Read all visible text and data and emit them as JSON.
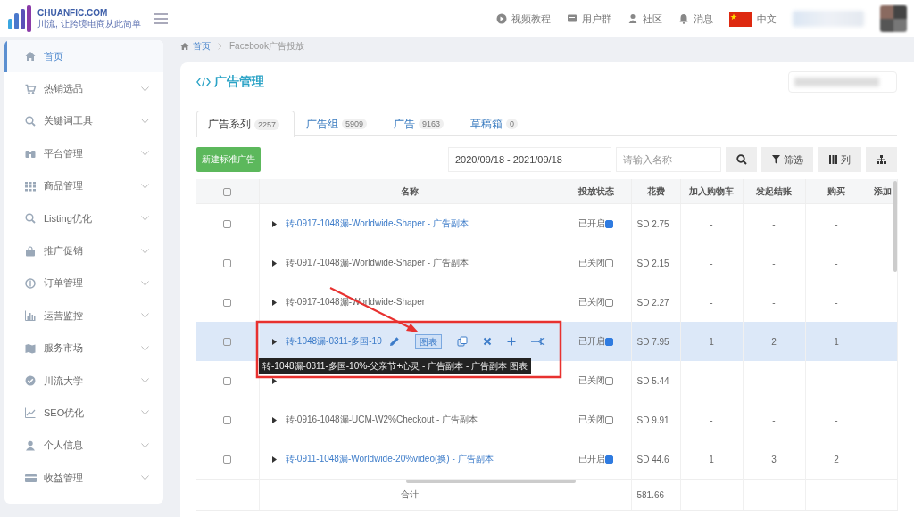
{
  "topbar": {
    "logo_title": "CHUANFIC.COM",
    "logo_subtitle": "川流, 让跨境电商从此简单",
    "links": [
      {
        "label": "视频教程"
      },
      {
        "label": "用户群"
      },
      {
        "label": "社区"
      },
      {
        "label": "消息"
      }
    ],
    "language": "中文"
  },
  "sidebar": {
    "items": [
      {
        "label": "首页",
        "selected": true,
        "expandable": false
      },
      {
        "label": "热销选品",
        "selected": false,
        "expandable": true
      },
      {
        "label": "关键词工具",
        "selected": false,
        "expandable": true
      },
      {
        "label": "平台管理",
        "selected": false,
        "expandable": true
      },
      {
        "label": "商品管理",
        "selected": false,
        "expandable": true
      },
      {
        "label": "Listing优化",
        "selected": false,
        "expandable": true
      },
      {
        "label": "推广促销",
        "selected": false,
        "expandable": true
      },
      {
        "label": "订单管理",
        "selected": false,
        "expandable": true
      },
      {
        "label": "运营监控",
        "selected": false,
        "expandable": true
      },
      {
        "label": "服务市场",
        "selected": false,
        "expandable": true
      },
      {
        "label": "川流大学",
        "selected": false,
        "expandable": true
      },
      {
        "label": "SEO优化",
        "selected": false,
        "expandable": true
      },
      {
        "label": "个人信息",
        "selected": false,
        "expandable": true
      },
      {
        "label": "收益管理",
        "selected": false,
        "expandable": true
      }
    ]
  },
  "breadcrumb": [
    "首页",
    "Facebook广告投放"
  ],
  "card": {
    "title": "广告管理"
  },
  "tabs": [
    {
      "label": "广告系列",
      "count": "2257",
      "selected": true
    },
    {
      "label": "广告组",
      "count": "5909",
      "selected": false
    },
    {
      "label": "广告",
      "count": "9163",
      "selected": false
    },
    {
      "label": "草稿箱",
      "count": "0",
      "selected": false
    }
  ],
  "toolbar": {
    "new_button": "新建标准广告",
    "date_range": "2020/09/18 - 2021/09/18",
    "search_placeholder": "请输入名称",
    "filter_button": "筛选",
    "columns_button": "列"
  },
  "table": {
    "all_checked": false,
    "columns": [
      "名称",
      "投放状态",
      "花费",
      "加入购物车",
      "发起结账",
      "购买",
      "添加"
    ],
    "rows": [
      {
        "checked": false,
        "selected": false,
        "name": "转-0917-1048漏-Worldwide-Shaper - 广告副本",
        "enabled": true,
        "status": "已开启",
        "spend": "SD 2.75",
        "cart": "-",
        "checkout": "-",
        "purchase": "-"
      },
      {
        "checked": false,
        "selected": false,
        "name": "转-0917-1048漏-Worldwide-Shaper - 广告副本",
        "enabled": false,
        "status": "已关闭",
        "spend": "SD 2.15",
        "cart": "-",
        "checkout": "-",
        "purchase": "-"
      },
      {
        "checked": false,
        "selected": false,
        "name": "转-0917-1048漏-Worldwide-Shaper",
        "enabled": false,
        "status": "已关闭",
        "spend": "SD 2.27",
        "cart": "-",
        "checkout": "-",
        "purchase": "-"
      },
      {
        "checked": false,
        "selected": true,
        "name": "转-1048漏-0311-多国-10",
        "enabled": true,
        "status": "已开启",
        "spend": "SD 7.95",
        "cart": "1",
        "checkout": "2",
        "purchase": "1",
        "actions": [
          {
            "kind": "edit"
          },
          {
            "kind": "chart",
            "label": "图表"
          },
          {
            "kind": "copy"
          },
          {
            "kind": "delete"
          },
          {
            "kind": "add"
          },
          {
            "kind": "split"
          }
        ]
      },
      {
        "checked": false,
        "selected": false,
        "enabled": false,
        "status": "已关闭",
        "spend": "SD 5.44",
        "cart": "-",
        "checkout": "-",
        "purchase": "-"
      },
      {
        "checked": false,
        "selected": false,
        "name": "转-0916-1048漏-UCM-W2%Checkout - 广告副本",
        "enabled": false,
        "status": "已关闭",
        "spend": "SD 9.91",
        "cart": "-",
        "checkout": "-",
        "purchase": "-"
      },
      {
        "checked": false,
        "selected": false,
        "name": "转-0911-1048漏-Worldwide-20%video(换)  - 广告副本",
        "enabled": true,
        "status": "已开启",
        "spend": "SD 44.6",
        "cart": "1",
        "checkout": "3",
        "purchase": "2"
      }
    ],
    "total": {
      "index": "-",
      "label": "合计",
      "status": "-",
      "spend": "581.66",
      "cart": "-",
      "checkout": "-",
      "purchase": "-"
    }
  },
  "tooltip": "转-1048漏-0311-多国-10%-父亲节+心灵 - 广告副本 - 广告副本 图表",
  "annotation": {
    "frame": true,
    "arrow": true
  }
}
